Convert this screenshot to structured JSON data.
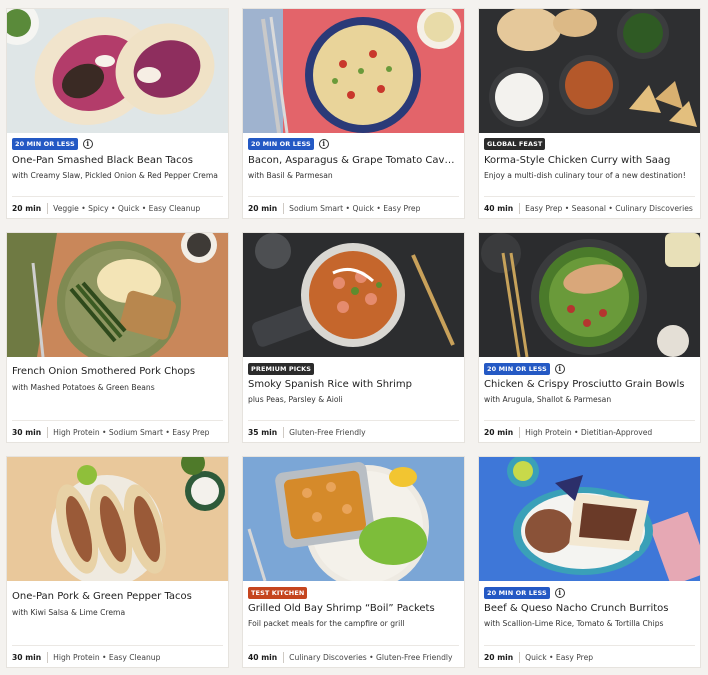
{
  "colors": {
    "badge_blue": "#2459c4",
    "badge_dark": "#2b2b2b",
    "badge_red": "#c5451e",
    "page_bg": "#f4f2ef"
  },
  "cards": [
    {
      "badge": "20 MIN OR LESS",
      "badge_style": "blue",
      "title": "One-Pan Smashed Black Bean Tacos",
      "subtitle": "with Creamy Slaw, Pickled Onion & Red Pepper Crema",
      "time": "20 min",
      "tags": "Veggie • Spicy • Quick • Easy Cleanup",
      "image": "tacos-black-bean"
    },
    {
      "badge": "20 MIN OR LESS",
      "badge_style": "blue",
      "title": "Bacon, Asparagus & Grape Tomato Cavatappi",
      "subtitle": "with Basil & Parmesan",
      "time": "20 min",
      "tags": "Sodium Smart • Quick • Easy Prep",
      "image": "pasta-bowl"
    },
    {
      "badge": "GLOBAL FEAST",
      "badge_style": "dark",
      "title": "Korma-Style Chicken Curry with Saag",
      "subtitle": "Enjoy a multi-dish culinary tour of a new destination!",
      "time": "40 min",
      "tags": "Easy Prep • Seasonal • Culinary Discoveries",
      "image": "curry-spread"
    },
    {
      "badge": "",
      "badge_style": "none",
      "title": "French Onion Smothered Pork Chops",
      "subtitle": "with Mashed Potatoes & Green Beans",
      "time": "30 min",
      "tags": "High Protein • Sodium Smart • Easy Prep",
      "image": "pork-chops"
    },
    {
      "badge": "PREMIUM PICKS",
      "badge_style": "dark",
      "title": "Smoky Spanish Rice with Shrimp",
      "subtitle": "plus Peas, Parsley & Aioli",
      "time": "35 min",
      "tags": "Gluten-Free Friendly",
      "image": "rice-skillet"
    },
    {
      "badge": "20 MIN OR LESS",
      "badge_style": "blue",
      "title": "Chicken & Crispy Prosciutto Grain Bowls",
      "subtitle": "with Arugula, Shallot & Parmesan",
      "time": "20 min",
      "tags": "High Protein • Dietitian-Approved",
      "image": "grain-bowl"
    },
    {
      "badge": "",
      "badge_style": "none",
      "title": "One-Pan Pork & Green Pepper Tacos",
      "subtitle": "with Kiwi Salsa & Lime Crema",
      "time": "30 min",
      "tags": "High Protein • Easy Cleanup",
      "image": "pork-tacos"
    },
    {
      "badge": "TEST KITCHEN",
      "badge_style": "red",
      "title": "Grilled Old Bay Shrimp “Boil” Packets",
      "subtitle": "Foil packet meals for the campfire or grill",
      "time": "40 min",
      "tags": "Culinary Discoveries • Gluten-Free Friendly",
      "image": "shrimp-foil"
    },
    {
      "badge": "20 MIN OR LESS",
      "badge_style": "blue",
      "title": "Beef & Queso Nacho Crunch Burritos",
      "subtitle": "with Scallion-Lime Rice, Tomato & Tortilla Chips",
      "time": "20 min",
      "tags": "Quick • Easy Prep",
      "image": "burritos"
    }
  ]
}
